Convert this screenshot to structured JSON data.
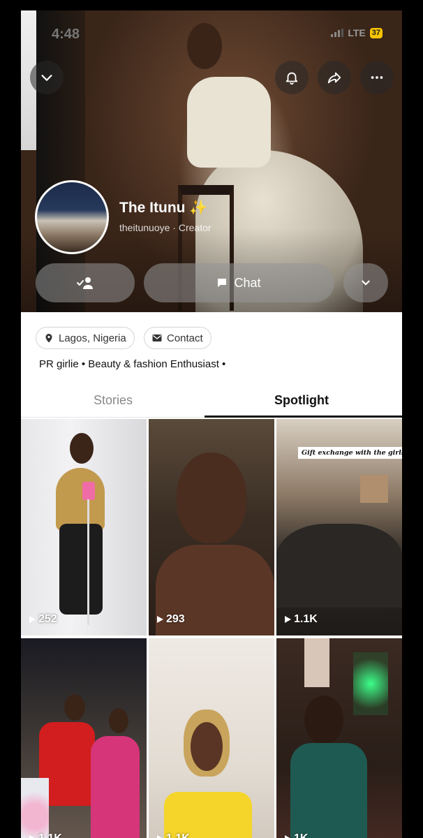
{
  "status_bar": {
    "time": "4:48",
    "network": "LTE",
    "battery": "37"
  },
  "profile": {
    "display_name": "The Itunu ✨",
    "username": "theitunuoye",
    "role": "Creator",
    "location": "Lagos, Nigeria",
    "contact_label": "Contact",
    "bio": "PR girlie • Beauty & fashion Enthusiast •"
  },
  "actions": {
    "chat_label": "Chat"
  },
  "tabs": [
    {
      "label": "Stories",
      "active": false
    },
    {
      "label": "Spotlight",
      "active": true
    }
  ],
  "spotlight": [
    {
      "views": "252"
    },
    {
      "views": "293"
    },
    {
      "views": "1.1K",
      "caption": "Gift exchange with the girls"
    },
    {
      "views": "1.1K"
    },
    {
      "views": "1.1K"
    },
    {
      "views": "1K"
    }
  ],
  "colors": {
    "accent_battery": "#f5c400",
    "active_tab": "#111111",
    "inactive_tab": "#888888"
  },
  "icons": [
    "chevron-down-icon",
    "bell-icon",
    "share-icon",
    "more-icon",
    "add-friend-icon",
    "chat-icon",
    "location-pin-icon",
    "mail-icon",
    "play-icon"
  ]
}
